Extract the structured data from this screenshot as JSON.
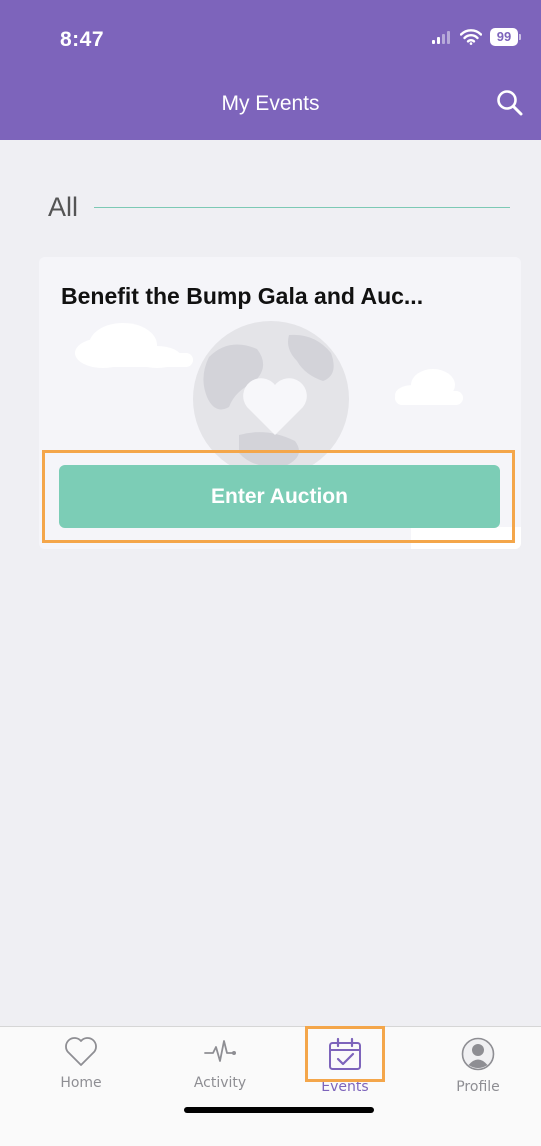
{
  "status_bar": {
    "time": "8:47",
    "battery": "99",
    "icons": [
      "signal-icon",
      "wifi-icon",
      "battery-icon"
    ]
  },
  "header": {
    "title": "My Events",
    "search_icon": "search-icon",
    "background": "#7d64bb"
  },
  "section": {
    "label": "All",
    "rule_color": "#7cc9b4"
  },
  "events": [
    {
      "title": "Benefit the Bump Gala and Auc...",
      "button_label": "Enter Auction",
      "button_color": "#7ccdb6",
      "artwork": "earth-heart-clouds-illustration"
    }
  ],
  "tab_bar": {
    "active_color": "#7d64bb",
    "inactive_color": "#8e8e93",
    "tabs": [
      {
        "label": "Home",
        "icon": "heart-icon",
        "active": false
      },
      {
        "label": "Activity",
        "icon": "pulse-icon",
        "active": false
      },
      {
        "label": "Events",
        "icon": "calendar-check-icon",
        "active": true
      },
      {
        "label": "Profile",
        "icon": "person-circle-icon",
        "active": false
      }
    ]
  },
  "highlight_color": "#f4a64a"
}
